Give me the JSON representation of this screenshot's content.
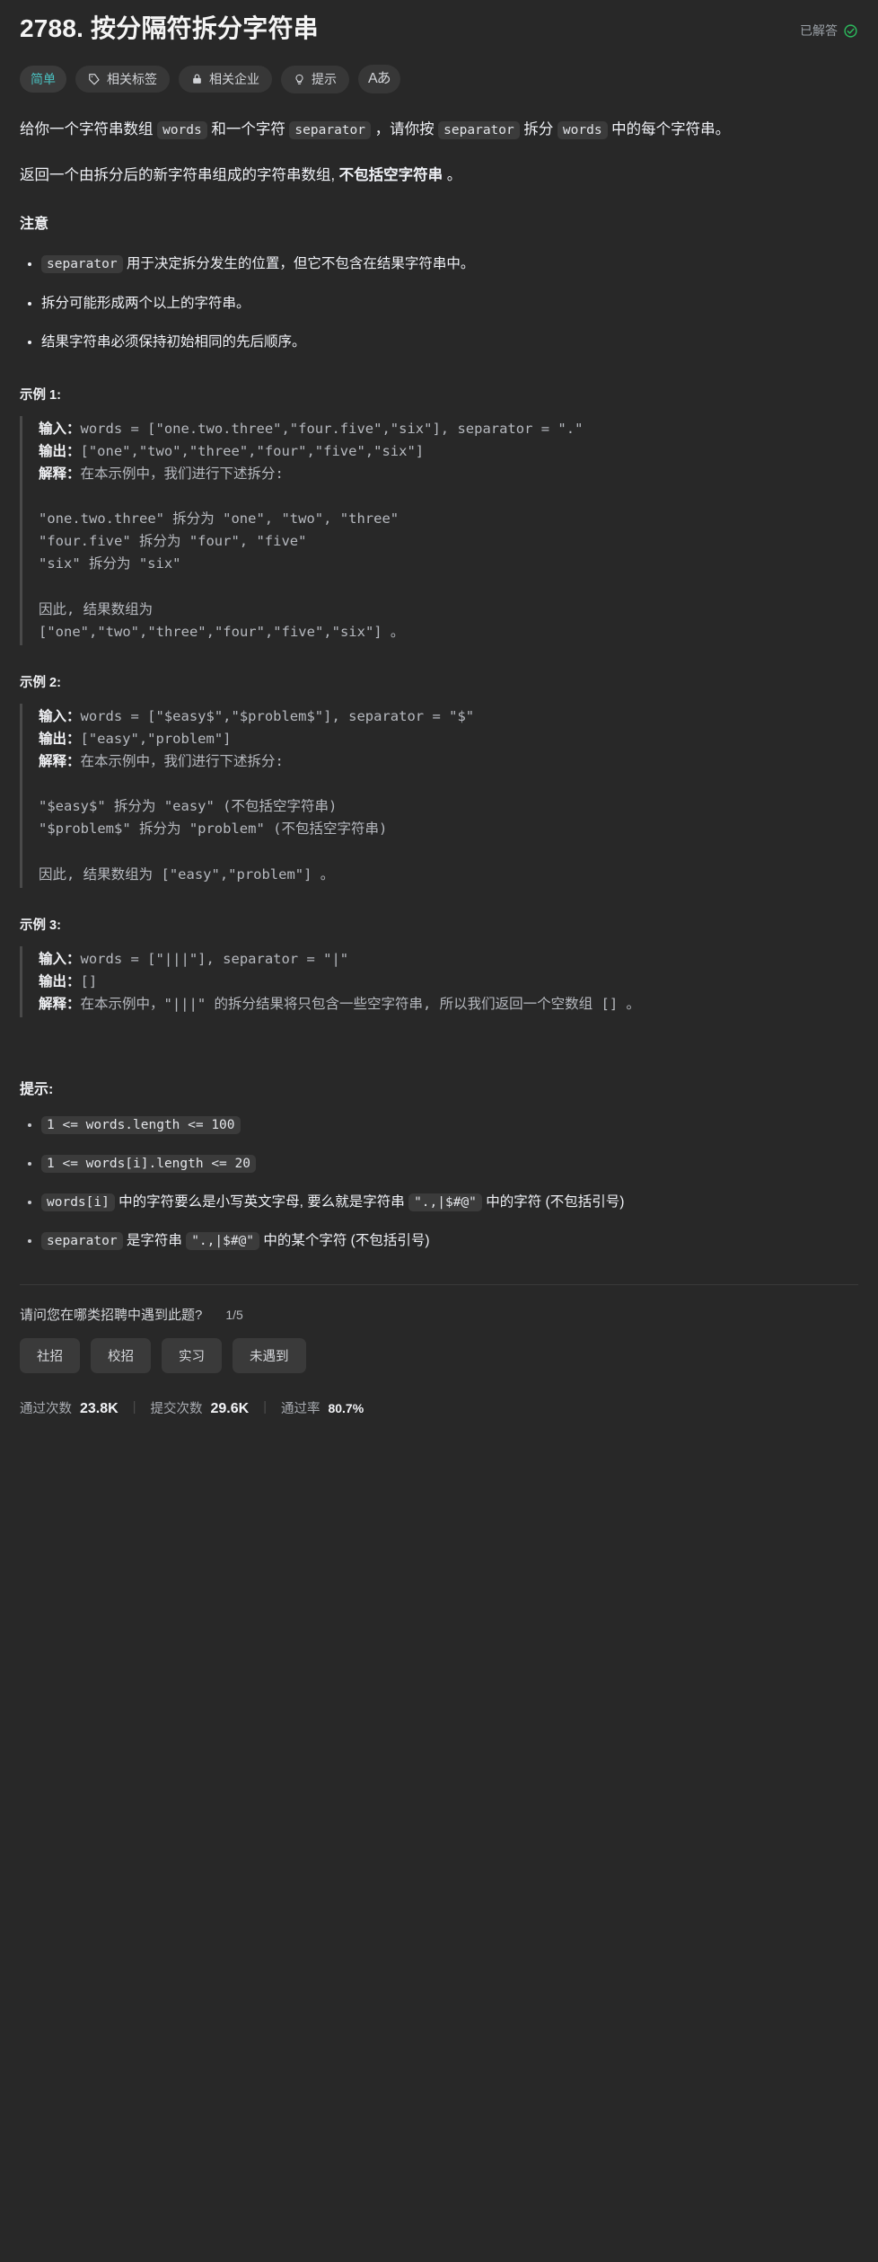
{
  "header": {
    "title": "2788. 按分隔符拆分字符串",
    "status_label": "已解答",
    "status_icon": "check-circle-icon",
    "status_color": "#2cbb5d"
  },
  "pills": [
    {
      "label": "简单",
      "icon": null,
      "name": "difficulty-badge"
    },
    {
      "label": "相关标签",
      "icon": "tag-icon",
      "name": "related-tags-button"
    },
    {
      "label": "相关企业",
      "icon": "lock-icon",
      "name": "related-companies-button"
    },
    {
      "label": "提示",
      "icon": "lightbulb-icon",
      "name": "hints-button"
    },
    {
      "label": "Aあ",
      "icon": "translate-icon",
      "name": "translate-button"
    }
  ],
  "description": {
    "para1": {
      "t1": "给你一个字符串数组 ",
      "c1": "words",
      "t2": " 和一个字符 ",
      "c2": "separator",
      "t3": " ，请你按 ",
      "c3": "separator",
      "t4": " 拆分 ",
      "c4": "words",
      "t5": " 中的每个字符串。"
    },
    "para2": {
      "t1": "返回一个由拆分后的新字符串组成的字符串数组, ",
      "bold": "不包括空字符串",
      "t2": " 。"
    },
    "notes_heading": "注意",
    "notes": [
      {
        "code": "separator",
        "text": " 用于决定拆分发生的位置，但它不包含在结果字符串中。"
      },
      {
        "code": null,
        "text": "拆分可能形成两个以上的字符串。"
      },
      {
        "code": null,
        "text": "结果字符串必须保持初始相同的先后顺序。"
      }
    ]
  },
  "examples": [
    {
      "label": "示例 1:",
      "lines": [
        {
          "bold": "输入：",
          "text": "words = [\"one.two.three\",\"four.five\",\"six\"], separator = \".\""
        },
        {
          "bold": "输出：",
          "text": "[\"one\",\"two\",\"three\",\"four\",\"five\",\"six\"]"
        },
        {
          "bold": "解释：",
          "text": "在本示例中，我们进行下述拆分:"
        },
        {
          "bold": "",
          "text": ""
        },
        {
          "bold": "",
          "text": "\"one.two.three\" 拆分为 \"one\", \"two\", \"three\""
        },
        {
          "bold": "",
          "text": "\"four.five\" 拆分为 \"four\", \"five\""
        },
        {
          "bold": "",
          "text": "\"six\" 拆分为 \"six\""
        },
        {
          "bold": "",
          "text": ""
        },
        {
          "bold": "",
          "text": "因此, 结果数组为"
        },
        {
          "bold": "",
          "text": "[\"one\",\"two\",\"three\",\"four\",\"five\",\"six\"] 。"
        }
      ]
    },
    {
      "label": "示例 2:",
      "lines": [
        {
          "bold": "输入：",
          "text": "words = [\"$easy$\",\"$problem$\"], separator = \"$\""
        },
        {
          "bold": "输出：",
          "text": "[\"easy\",\"problem\"]"
        },
        {
          "bold": "解释：",
          "text": "在本示例中，我们进行下述拆分:"
        },
        {
          "bold": "",
          "text": ""
        },
        {
          "bold": "",
          "text": "\"$easy$\" 拆分为 \"easy\" (不包括空字符串)"
        },
        {
          "bold": "",
          "text": "\"$problem$\" 拆分为 \"problem\" (不包括空字符串)"
        },
        {
          "bold": "",
          "text": ""
        },
        {
          "bold": "",
          "text": "因此, 结果数组为 [\"easy\",\"problem\"] 。"
        }
      ]
    },
    {
      "label": "示例 3:",
      "lines": [
        {
          "bold": "输入：",
          "text": "words = [\"|||\"], separator = \"|\""
        },
        {
          "bold": "输出：",
          "text": "[]"
        },
        {
          "bold": "解释：",
          "text": "在本示例中，\"|||\" 的拆分结果将只包含一些空字符串, 所以我们返回一个空数组 [] 。"
        }
      ]
    }
  ],
  "constraints": {
    "heading": "提示:",
    "items": [
      {
        "parts": [
          {
            "type": "code",
            "v": "1 <= words.length <= 100"
          }
        ]
      },
      {
        "parts": [
          {
            "type": "code",
            "v": "1 <= words[i].length <= 20"
          }
        ]
      },
      {
        "parts": [
          {
            "type": "code",
            "v": "words[i]"
          },
          {
            "type": "text",
            "v": " 中的字符要么是小写英文字母, 要么就是字符串 "
          },
          {
            "type": "code",
            "v": "\".,|$#@\""
          },
          {
            "type": "text",
            "v": " 中的字符 (不包括引号)"
          }
        ]
      },
      {
        "parts": [
          {
            "type": "code",
            "v": "separator"
          },
          {
            "type": "text",
            "v": " 是字符串 "
          },
          {
            "type": "code",
            "v": "\".,|$#@\""
          },
          {
            "type": "text",
            "v": " 中的某个字符 (不包括引号)"
          }
        ]
      }
    ]
  },
  "survey": {
    "question": "请问您在哪类招聘中遇到此题?",
    "counter": "1/5",
    "options": [
      "社招",
      "校招",
      "实习",
      "未遇到"
    ]
  },
  "stats": [
    {
      "label": "通过次数",
      "value": "23.8K"
    },
    {
      "label": "提交次数",
      "value": "29.6K"
    },
    {
      "label": "通过率",
      "value": "80.7%"
    }
  ]
}
